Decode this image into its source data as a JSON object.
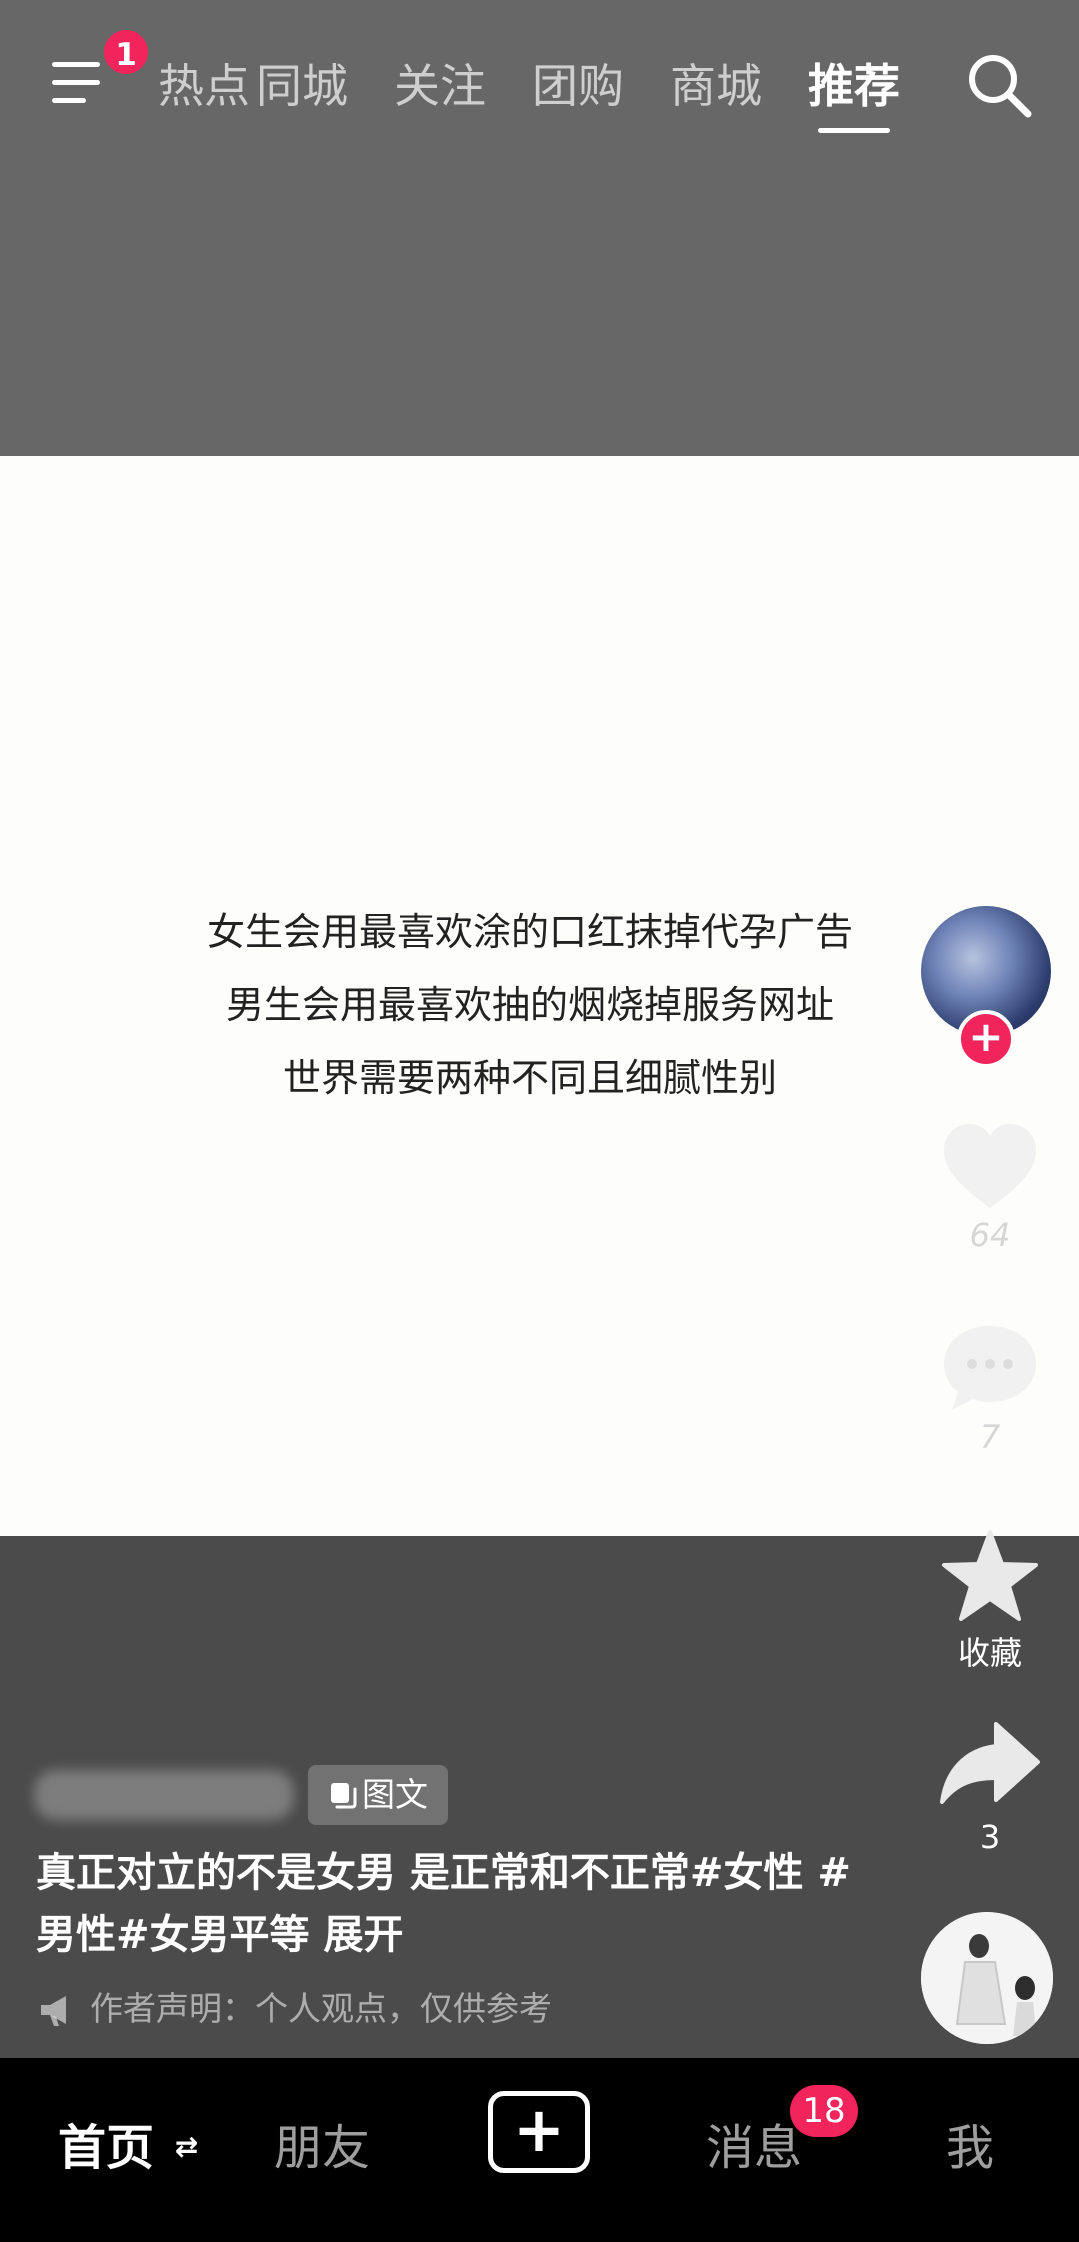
{
  "top_nav": {
    "menu_badge": "1",
    "tabs": [
      {
        "label": "热点"
      },
      {
        "label": "同城"
      },
      {
        "label": "关注"
      },
      {
        "label": "团购"
      },
      {
        "label": "商城"
      },
      {
        "label": "推荐",
        "active": true
      }
    ]
  },
  "post": {
    "content_lines": [
      "女生会用最喜欢涂的口红抹掉代孕广告",
      "男生会用最喜欢抽的烟烧掉服务网址",
      "世界需要两种不同且细腻性别"
    ],
    "tag_badge": "图文",
    "caption": "真正对立的不是女男 是正常和不正常#女性 #男性#女男平等  展开",
    "disclaimer": "作者声明：个人观点，仅供参考"
  },
  "actions": {
    "likes": "64",
    "comments": "7",
    "favorite_label": "收藏",
    "shares": "3"
  },
  "bottom_nav": {
    "home": "首页",
    "friends": "朋友",
    "messages": "消息",
    "messages_badge": "18",
    "me": "我"
  },
  "colors": {
    "accent": "#f1255b",
    "top_bg": "#676767",
    "content_bg": "#fdfdfc",
    "info_bg": "#4b4b4b",
    "nav_bg": "#000000"
  }
}
